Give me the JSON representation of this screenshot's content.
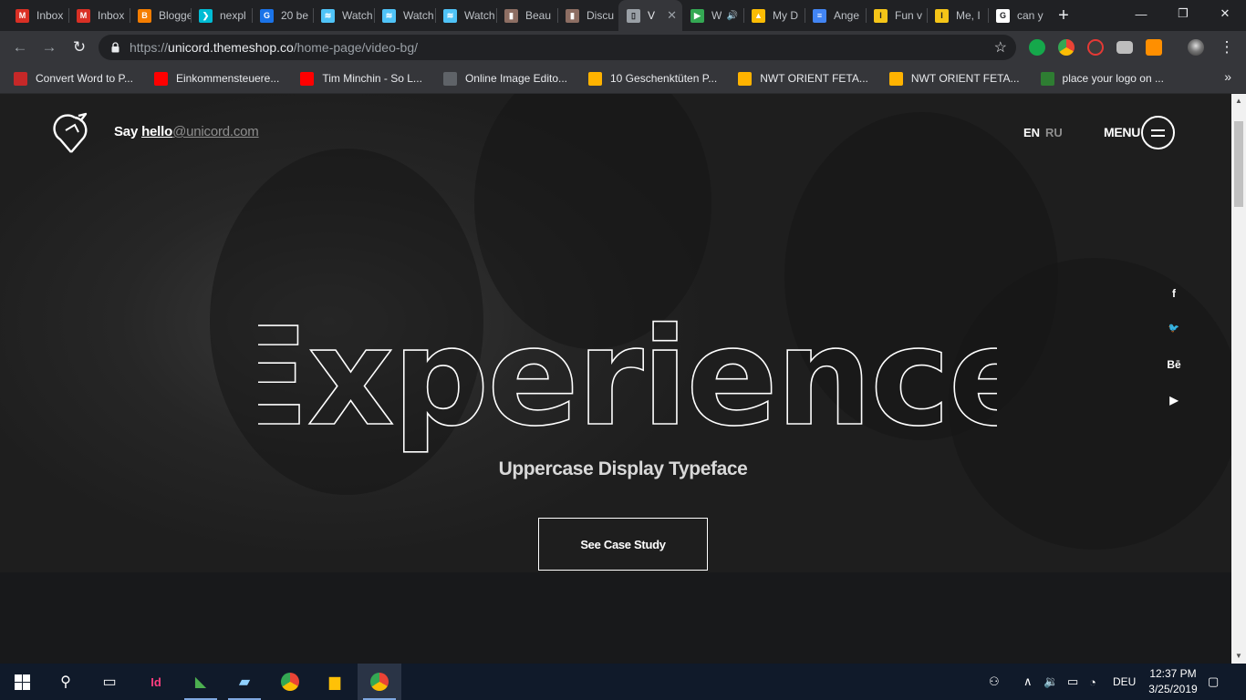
{
  "browser": {
    "tabs": [
      {
        "title": "Inbox",
        "icon": "gmail-icon",
        "color": "#d93025",
        "glyph": "M"
      },
      {
        "title": "Inbox",
        "icon": "gmail-icon",
        "color": "#d93025",
        "glyph": "M"
      },
      {
        "title": "Blogger",
        "icon": "blogger-icon",
        "color": "#f57d00",
        "glyph": "B"
      },
      {
        "title": "nexpl",
        "icon": "chevron-icon",
        "color": "#00bcd4",
        "glyph": "❯"
      },
      {
        "title": "20 be",
        "icon": "g-icon",
        "color": "#1a73e8",
        "glyph": "G"
      },
      {
        "title": "Watch",
        "icon": "wave-icon",
        "color": "#4fc3f7",
        "glyph": "≋"
      },
      {
        "title": "Watch",
        "icon": "wave-icon",
        "color": "#4fc3f7",
        "glyph": "≋"
      },
      {
        "title": "Watch",
        "icon": "wave-icon",
        "color": "#4fc3f7",
        "glyph": "≋"
      },
      {
        "title": "Beau",
        "icon": "bag-icon",
        "color": "#8d6e63",
        "glyph": "▮"
      },
      {
        "title": "Discu",
        "icon": "bag-icon",
        "color": "#8d6e63",
        "glyph": "▮"
      },
      {
        "title": "V",
        "icon": "page-icon",
        "color": "#9aa0a6",
        "glyph": "▯",
        "active": true
      },
      {
        "title": "W",
        "icon": "play-icon",
        "color": "#34a853",
        "glyph": "▶",
        "audio": true
      },
      {
        "title": "My D",
        "icon": "drive-icon",
        "color": "#fbbc04",
        "glyph": "▲"
      },
      {
        "title": "Ange",
        "icon": "docs-icon",
        "color": "#4285f4",
        "glyph": "≡"
      },
      {
        "title": "Fun v",
        "icon": "imdb-icon",
        "color": "#f5c518",
        "glyph": "I"
      },
      {
        "title": "Me, I",
        "icon": "imdb-icon",
        "color": "#f5c518",
        "glyph": "I"
      },
      {
        "title": "can y",
        "icon": "google-icon",
        "color": "#ffffff",
        "glyph": "G"
      }
    ],
    "url_scheme": "https://",
    "url_host": "unicord.themeshop.co",
    "url_path": "/home-page/video-bg/",
    "bookmarks": [
      {
        "label": "Convert Word to P...",
        "icon": "flag-icon",
        "color": "#c62828"
      },
      {
        "label": "Einkommensteuere...",
        "icon": "youtube-icon",
        "color": "#ff0000"
      },
      {
        "label": "Tim Minchin - So L...",
        "icon": "youtube-icon",
        "color": "#ff0000"
      },
      {
        "label": "Online Image Edito...",
        "icon": "globe-icon",
        "color": "#5f6368"
      },
      {
        "label": "10 Geschenktüten P...",
        "icon": "shop-icon",
        "color": "#ffb300"
      },
      {
        "label": "NWT ORIENT FETA...",
        "icon": "shop-icon",
        "color": "#ffb300"
      },
      {
        "label": "NWT ORIENT FETA...",
        "icon": "shop-icon",
        "color": "#ffb300"
      },
      {
        "label": "place your logo on ...",
        "icon": "fi-icon",
        "color": "#2e7d32"
      }
    ]
  },
  "site": {
    "say": "Say",
    "hello_word": "hello",
    "hello_domain": "@unicord.com",
    "lang_en": "EN",
    "lang_ru": "RU",
    "menu_label": "MENU",
    "headline": "Experience",
    "subtitle": "Uppercase Display Typeface",
    "cta": "See Case Study",
    "social": [
      {
        "name": "facebook-icon",
        "glyph": "f"
      },
      {
        "name": "twitter-icon",
        "glyph": "🐦"
      },
      {
        "name": "behance-icon",
        "glyph": "Bē"
      },
      {
        "name": "youtube-icon",
        "glyph": "▶"
      }
    ]
  },
  "taskbar": {
    "time": "12:37 PM",
    "date": "3/25/2019",
    "language": "DEU"
  },
  "colors": {
    "page_bg": "#18191b",
    "hero_text": "#ffffff",
    "muted": "#8e8e8e"
  }
}
